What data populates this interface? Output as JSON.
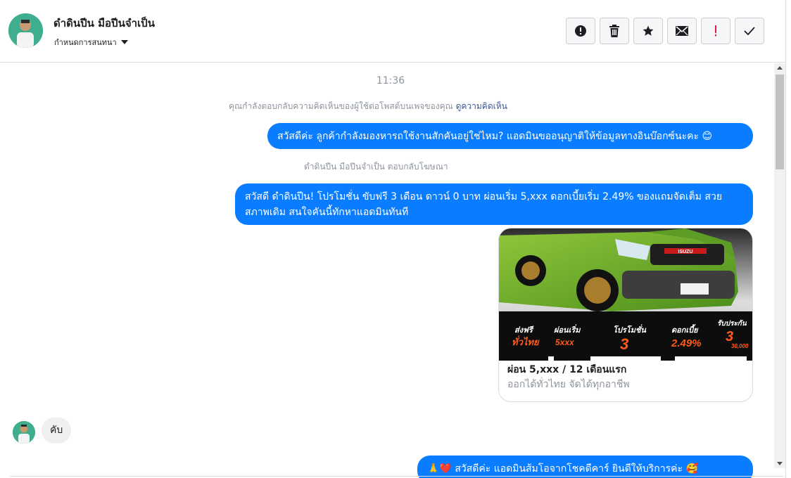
{
  "header": {
    "name": "ดำดินปีน มือปีนจำเป็น",
    "assign_label": "กำหนดการสนทนา",
    "actions": [
      {
        "name": "spam-button",
        "icon": "alert-circle-icon"
      },
      {
        "name": "delete-button",
        "icon": "trash-icon"
      },
      {
        "name": "star-button",
        "icon": "star-icon"
      },
      {
        "name": "mark-unread-button",
        "icon": "envelope-icon"
      },
      {
        "name": "follow-up-button",
        "icon": "exclamation-icon"
      },
      {
        "name": "mark-done-button",
        "icon": "check-icon"
      }
    ]
  },
  "conversation": {
    "timestamp": "11:36",
    "reply_notice": "คุณกำลังตอบกลับความคิดเห็นของผู้ใช้ต่อโพสต์บนเพจของคุณ",
    "reply_notice_link": "ดูความคิดเห็น",
    "msg1": "สวัสดีค่ะ ลูกค้ากำลังมองหารถใช้งานสักคันอยู่ใช่ไหม? แอดมินขออนุญาติให้ข้อมูลทางอินบ๊อกซ์นะคะ 😊",
    "ad_reply_note": "ดำดินปีน มือปีนจำเป็น ตอบกลับโฆษณา",
    "msg2": "สวัสดี ดำดินปีน! โปรโมชั่น ขับฟรี 3 เดือน ดาวน์ 0 บาท ผ่อนเริ่ม 5,xxx  ดอกเบี้ยเริ่ม 2.49% ของแถมจัดเต็ม สวย สภาพเดิม สนใจคันนี้ทักหาแอดมินทันที",
    "card": {
      "title": "ผ่อน 5,xxx / 12 เดือนแรก",
      "subtitle": "ออกได้ทั่วไทย จัดได้ทุกอาชีพ",
      "image_labels": {
        "brand": "ISUZU",
        "free_shipping": "ส่งฟรี",
        "nationwide": "ทั่วไทย",
        "installment": "ผ่อนเริ่ม",
        "installment_value": "5xxx",
        "promotion": "โปรโมชั่น",
        "promotion_value": "3",
        "interest": "ดอกเบี้ย",
        "interest_value": "2.49%",
        "warranty": "รับประกัน",
        "warranty_value": "3",
        "warranty_km": "30,000"
      }
    },
    "incoming_msg": "คับ",
    "msg3": "🙏❤️ สวัสดีค่ะ แอดมินส้มโอจากโชคดีคาร์ ยินดีให้บริการค่ะ 🥰"
  },
  "colors": {
    "accent": "#0a7cff",
    "incoming_bg": "#f1f0f0",
    "muted_text": "#8d949e",
    "link": "#385898",
    "car_green": "#6fae2a"
  }
}
